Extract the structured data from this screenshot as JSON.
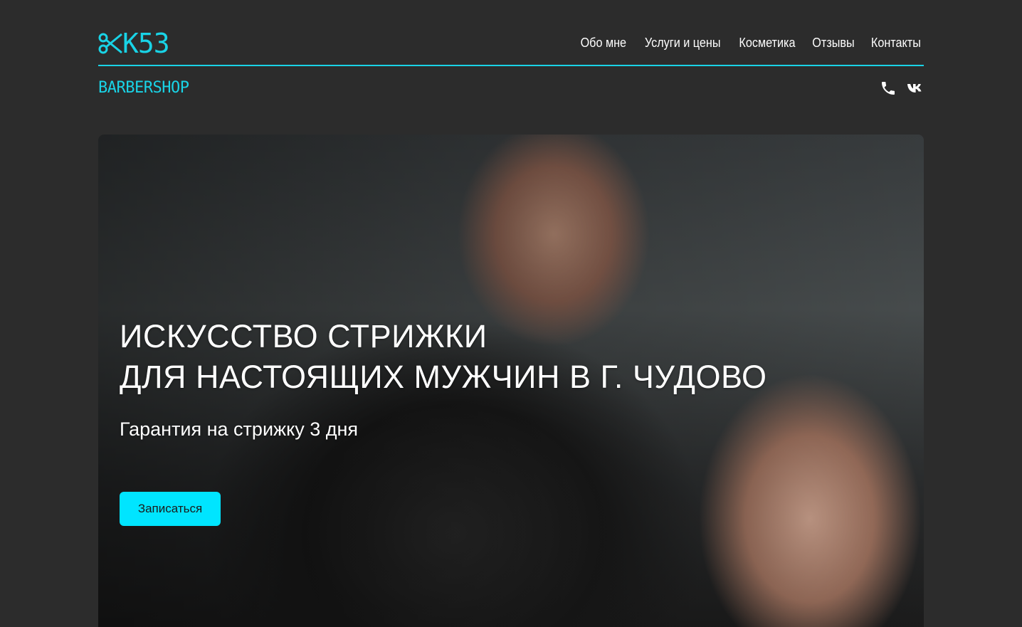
{
  "brand": {
    "logo_text": "K53",
    "tagline": "BARBERSHOP",
    "accent_color": "#19d3e6"
  },
  "nav": {
    "items": [
      {
        "label": "Обо мне"
      },
      {
        "label": "Услуги и цены"
      },
      {
        "label": "Косметика"
      },
      {
        "label": "Отзывы"
      },
      {
        "label": "Контакты"
      }
    ]
  },
  "socials": {
    "icons": [
      "phone-icon",
      "vk-icon"
    ]
  },
  "hero": {
    "title_line1": "ИСКУССТВО СТРИЖКИ",
    "title_line2": "ДЛЯ НАСТОЯЩИХ МУЖЧИН В Г. ЧУДОВО",
    "subtitle": "Гарантия на стрижку 3 дня",
    "cta_label": "Записаться",
    "cta_color": "#00e5ff"
  }
}
